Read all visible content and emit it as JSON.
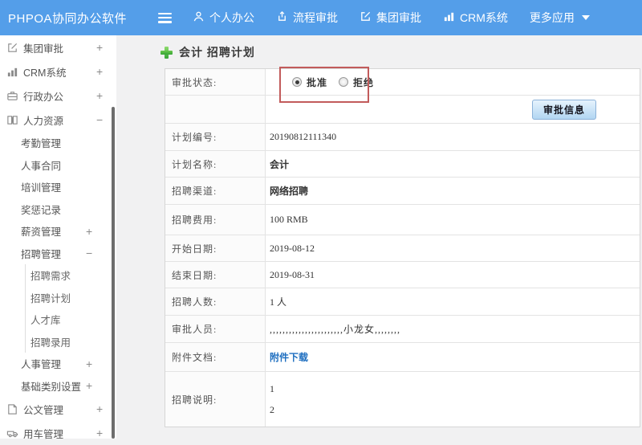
{
  "colors": {
    "header_bg": "#549ee9",
    "link_blue": "#1f6fc0",
    "annotation_red": "#c25b5b",
    "plus_green": "#35a435"
  },
  "header": {
    "logo": "PHPOA协同办公软件",
    "nav": [
      {
        "label": "个人办公",
        "icon": "user-icon"
      },
      {
        "label": "流程审批",
        "icon": "process-icon"
      },
      {
        "label": "集团审批",
        "icon": "edit-icon"
      },
      {
        "label": "CRM系统",
        "icon": "bar-chart-icon"
      },
      {
        "label": "更多应用",
        "icon": "caret-down-icon"
      }
    ]
  },
  "sidebar": {
    "items": [
      {
        "label": "集团审批",
        "level": 1,
        "toggle": "+",
        "icon": "edit-icon"
      },
      {
        "label": "CRM系统",
        "level": 1,
        "toggle": "+",
        "icon": "bar-chart-icon"
      },
      {
        "label": "行政办公",
        "level": 1,
        "toggle": "+",
        "icon": "briefcase-icon"
      },
      {
        "label": "人力资源",
        "level": 1,
        "toggle": "−",
        "icon": "book-icon"
      },
      {
        "label": "考勤管理",
        "level": 2,
        "toggle": ""
      },
      {
        "label": "人事合同",
        "level": 2,
        "toggle": ""
      },
      {
        "label": "培训管理",
        "level": 2,
        "toggle": ""
      },
      {
        "label": "奖惩记录",
        "level": 2,
        "toggle": ""
      },
      {
        "label": "薪资管理",
        "level": 2,
        "toggle": "+"
      },
      {
        "label": "招聘管理",
        "level": 2,
        "toggle": "−"
      },
      {
        "label": "招聘需求",
        "level": 3,
        "toggle": ""
      },
      {
        "label": "招聘计划",
        "level": 3,
        "toggle": ""
      },
      {
        "label": "人才库",
        "level": 3,
        "toggle": ""
      },
      {
        "label": "招聘录用",
        "level": 3,
        "toggle": ""
      },
      {
        "label": "人事管理",
        "level": 2,
        "toggle": "+"
      },
      {
        "label": "基础类别设置",
        "level": 2,
        "toggle": "+"
      },
      {
        "label": "公文管理",
        "level": 1,
        "toggle": "+",
        "icon": "document-icon"
      },
      {
        "label": "用车管理",
        "level": 1,
        "toggle": "+",
        "icon": "vehicle-icon"
      }
    ]
  },
  "main": {
    "page_title": "会计 招聘计划",
    "form": {
      "status_label": "审批状态:",
      "radios": [
        {
          "label": "批准",
          "checked": true
        },
        {
          "label": "拒绝",
          "checked": false
        }
      ],
      "approve_button": "审批信息",
      "rows": [
        {
          "label": "计划编号:",
          "value": "20190812111340"
        },
        {
          "label": "计划名称:",
          "value": "会计"
        },
        {
          "label": "招聘渠道:",
          "value": "网络招聘"
        },
        {
          "label": "招聘费用:",
          "value": "100 RMB"
        },
        {
          "label": "开始日期:",
          "value": "2019-08-12"
        },
        {
          "label": "结束日期:",
          "value": "2019-08-31"
        },
        {
          "label": "招聘人数:",
          "value": "1 人"
        },
        {
          "label": "审批人员:",
          "value": ",,,,,,,,,,,,,,,,,,,,,,,小龙女,,,,,,,,"
        },
        {
          "label": "附件文档:",
          "value": "附件下载"
        },
        {
          "label": "招聘说明:",
          "lines": [
            "1",
            "2"
          ]
        }
      ]
    }
  }
}
